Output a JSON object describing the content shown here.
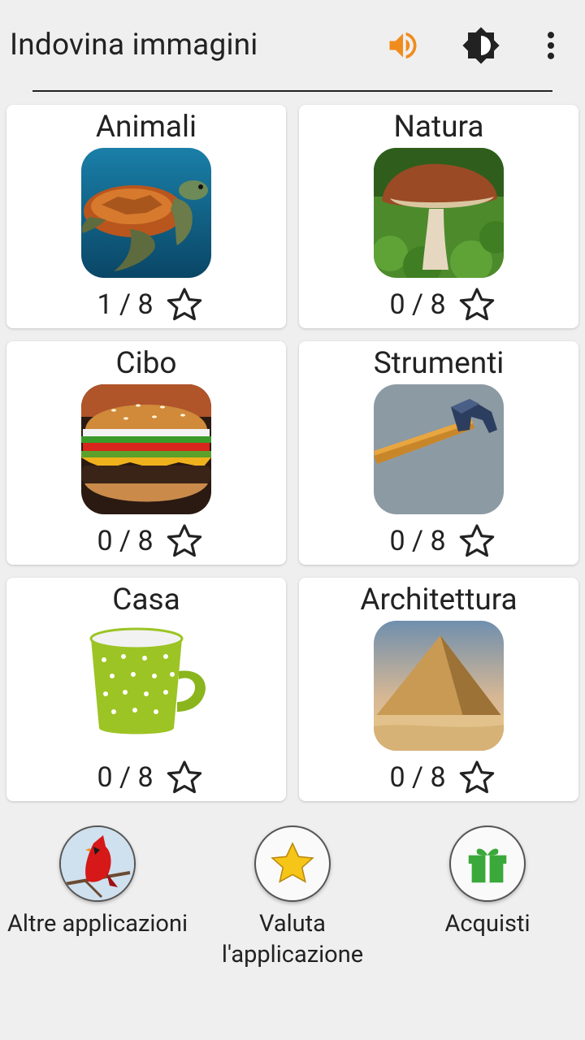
{
  "app": {
    "title": "Indovina immagini"
  },
  "toolbar": {
    "sound_icon": "volume-icon",
    "theme_icon": "brightness-icon",
    "menu_icon": "more-vert-icon",
    "sound_color": "#f08c1e"
  },
  "categories": [
    {
      "name": "Animali",
      "score": "1 / 8",
      "image": "turtle"
    },
    {
      "name": "Natura",
      "score": "0 / 8",
      "image": "mushroom"
    },
    {
      "name": "Cibo",
      "score": "0 / 8",
      "image": "burger"
    },
    {
      "name": "Strumenti",
      "score": "0 / 8",
      "image": "hammer"
    },
    {
      "name": "Casa",
      "score": "0 / 8",
      "image": "mug"
    },
    {
      "name": "Architettura",
      "score": "0 / 8",
      "image": "pyramid"
    }
  ],
  "bottom": {
    "other_apps": "Altre applicazioni",
    "rate_app": "Valuta l'applicazione",
    "purchases": "Acquisti"
  }
}
